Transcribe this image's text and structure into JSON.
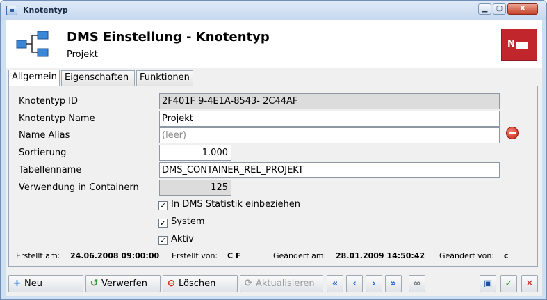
{
  "window": {
    "title": "Knotentyp",
    "min": "▁",
    "max": "▢",
    "close": "X"
  },
  "header": {
    "title": "DMS Einstellung - Knotentyp",
    "subtitle": "Projekt",
    "badge": "N"
  },
  "tabs": [
    {
      "label": "Allgemein"
    },
    {
      "label": "Eigenschaften"
    },
    {
      "label": "Funktionen"
    }
  ],
  "form": {
    "id_label": "Knotentyp ID",
    "id_value": "2F401F          9-4E1A-8543-          2C44AF",
    "name_label": "Knotentyp Name",
    "name_value": "Projekt",
    "alias_label": "Name Alias",
    "alias_placeholder": "(leer)",
    "sort_label": "Sortierung",
    "sort_value": "1.000",
    "table_label": "Tabellenname",
    "table_value": "DMS_CONTAINER_REL_PROJEKT",
    "usage_label": "Verwendung in Containern",
    "usage_value": "125",
    "checkboxes": [
      {
        "label": "In DMS Statistik einbeziehen",
        "checked": true
      },
      {
        "label": "System",
        "checked": true
      },
      {
        "label": "Aktiv",
        "checked": true
      }
    ]
  },
  "info": {
    "created_at_label": "Erstellt am:",
    "created_at": "24.06.2008 09:00:00",
    "created_by_label": "Erstellt von:",
    "created_by": "C          F",
    "changed_at_label": "Geändert am:",
    "changed_at": "28.01.2009 14:50:42",
    "changed_by_label": "Geändert von:",
    "changed_by": "c"
  },
  "toolbar": {
    "new": "Neu",
    "discard": "Verwerfen",
    "delete": "Löschen",
    "refresh": "Aktualisieren",
    "first": "«",
    "prev": "‹",
    "next": "›",
    "last": "»"
  },
  "colors": {
    "accent": "#c0262c",
    "nav": "#1f5fcf",
    "frame": "#cfe0f3"
  }
}
